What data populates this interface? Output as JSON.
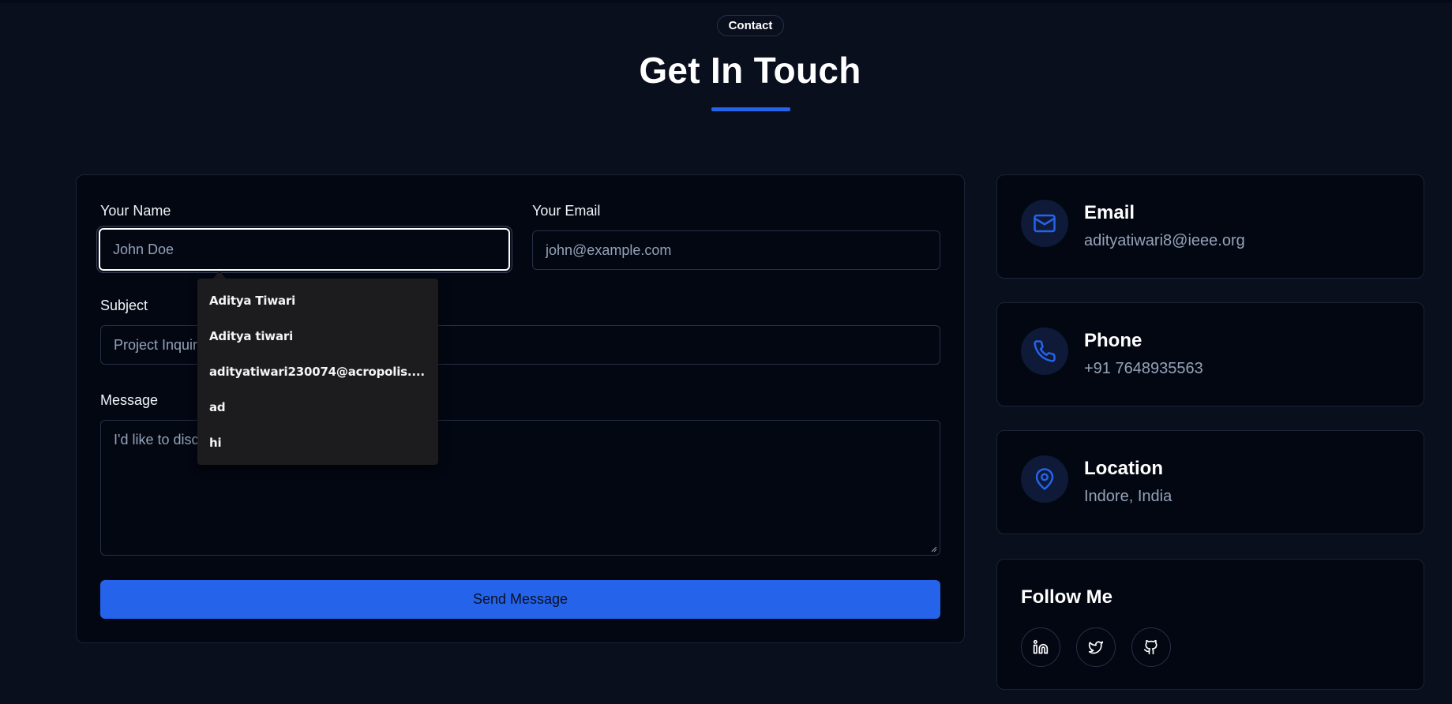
{
  "section": {
    "badge": "Contact",
    "title": "Get In Touch",
    "accent_color": "#2563eb"
  },
  "form": {
    "name_label": "Your Name",
    "name_placeholder": "John Doe",
    "email_label": "Your Email",
    "email_placeholder": "john@example.com",
    "subject_label": "Subject",
    "subject_placeholder_visible": "Project Inquir",
    "message_label": "Message",
    "message_placeholder_visible": "I'd like to disc",
    "submit_label": "Send Message"
  },
  "autocomplete": {
    "items": [
      "Aditya Tiwari",
      "Aditya tiwari",
      "adityatiwari230074@acropolis....",
      "ad",
      "hi"
    ]
  },
  "contact_info": {
    "email": {
      "title": "Email",
      "value": "adityatiwari8@ieee.org",
      "icon": "mail-icon"
    },
    "phone": {
      "title": "Phone",
      "value": "+91 7648935563",
      "icon": "phone-icon"
    },
    "location": {
      "title": "Location",
      "value": "Indore, India",
      "icon": "map-pin-icon"
    }
  },
  "follow": {
    "title": "Follow Me",
    "links": [
      "linkedin-icon",
      "twitter-icon",
      "github-icon"
    ]
  }
}
